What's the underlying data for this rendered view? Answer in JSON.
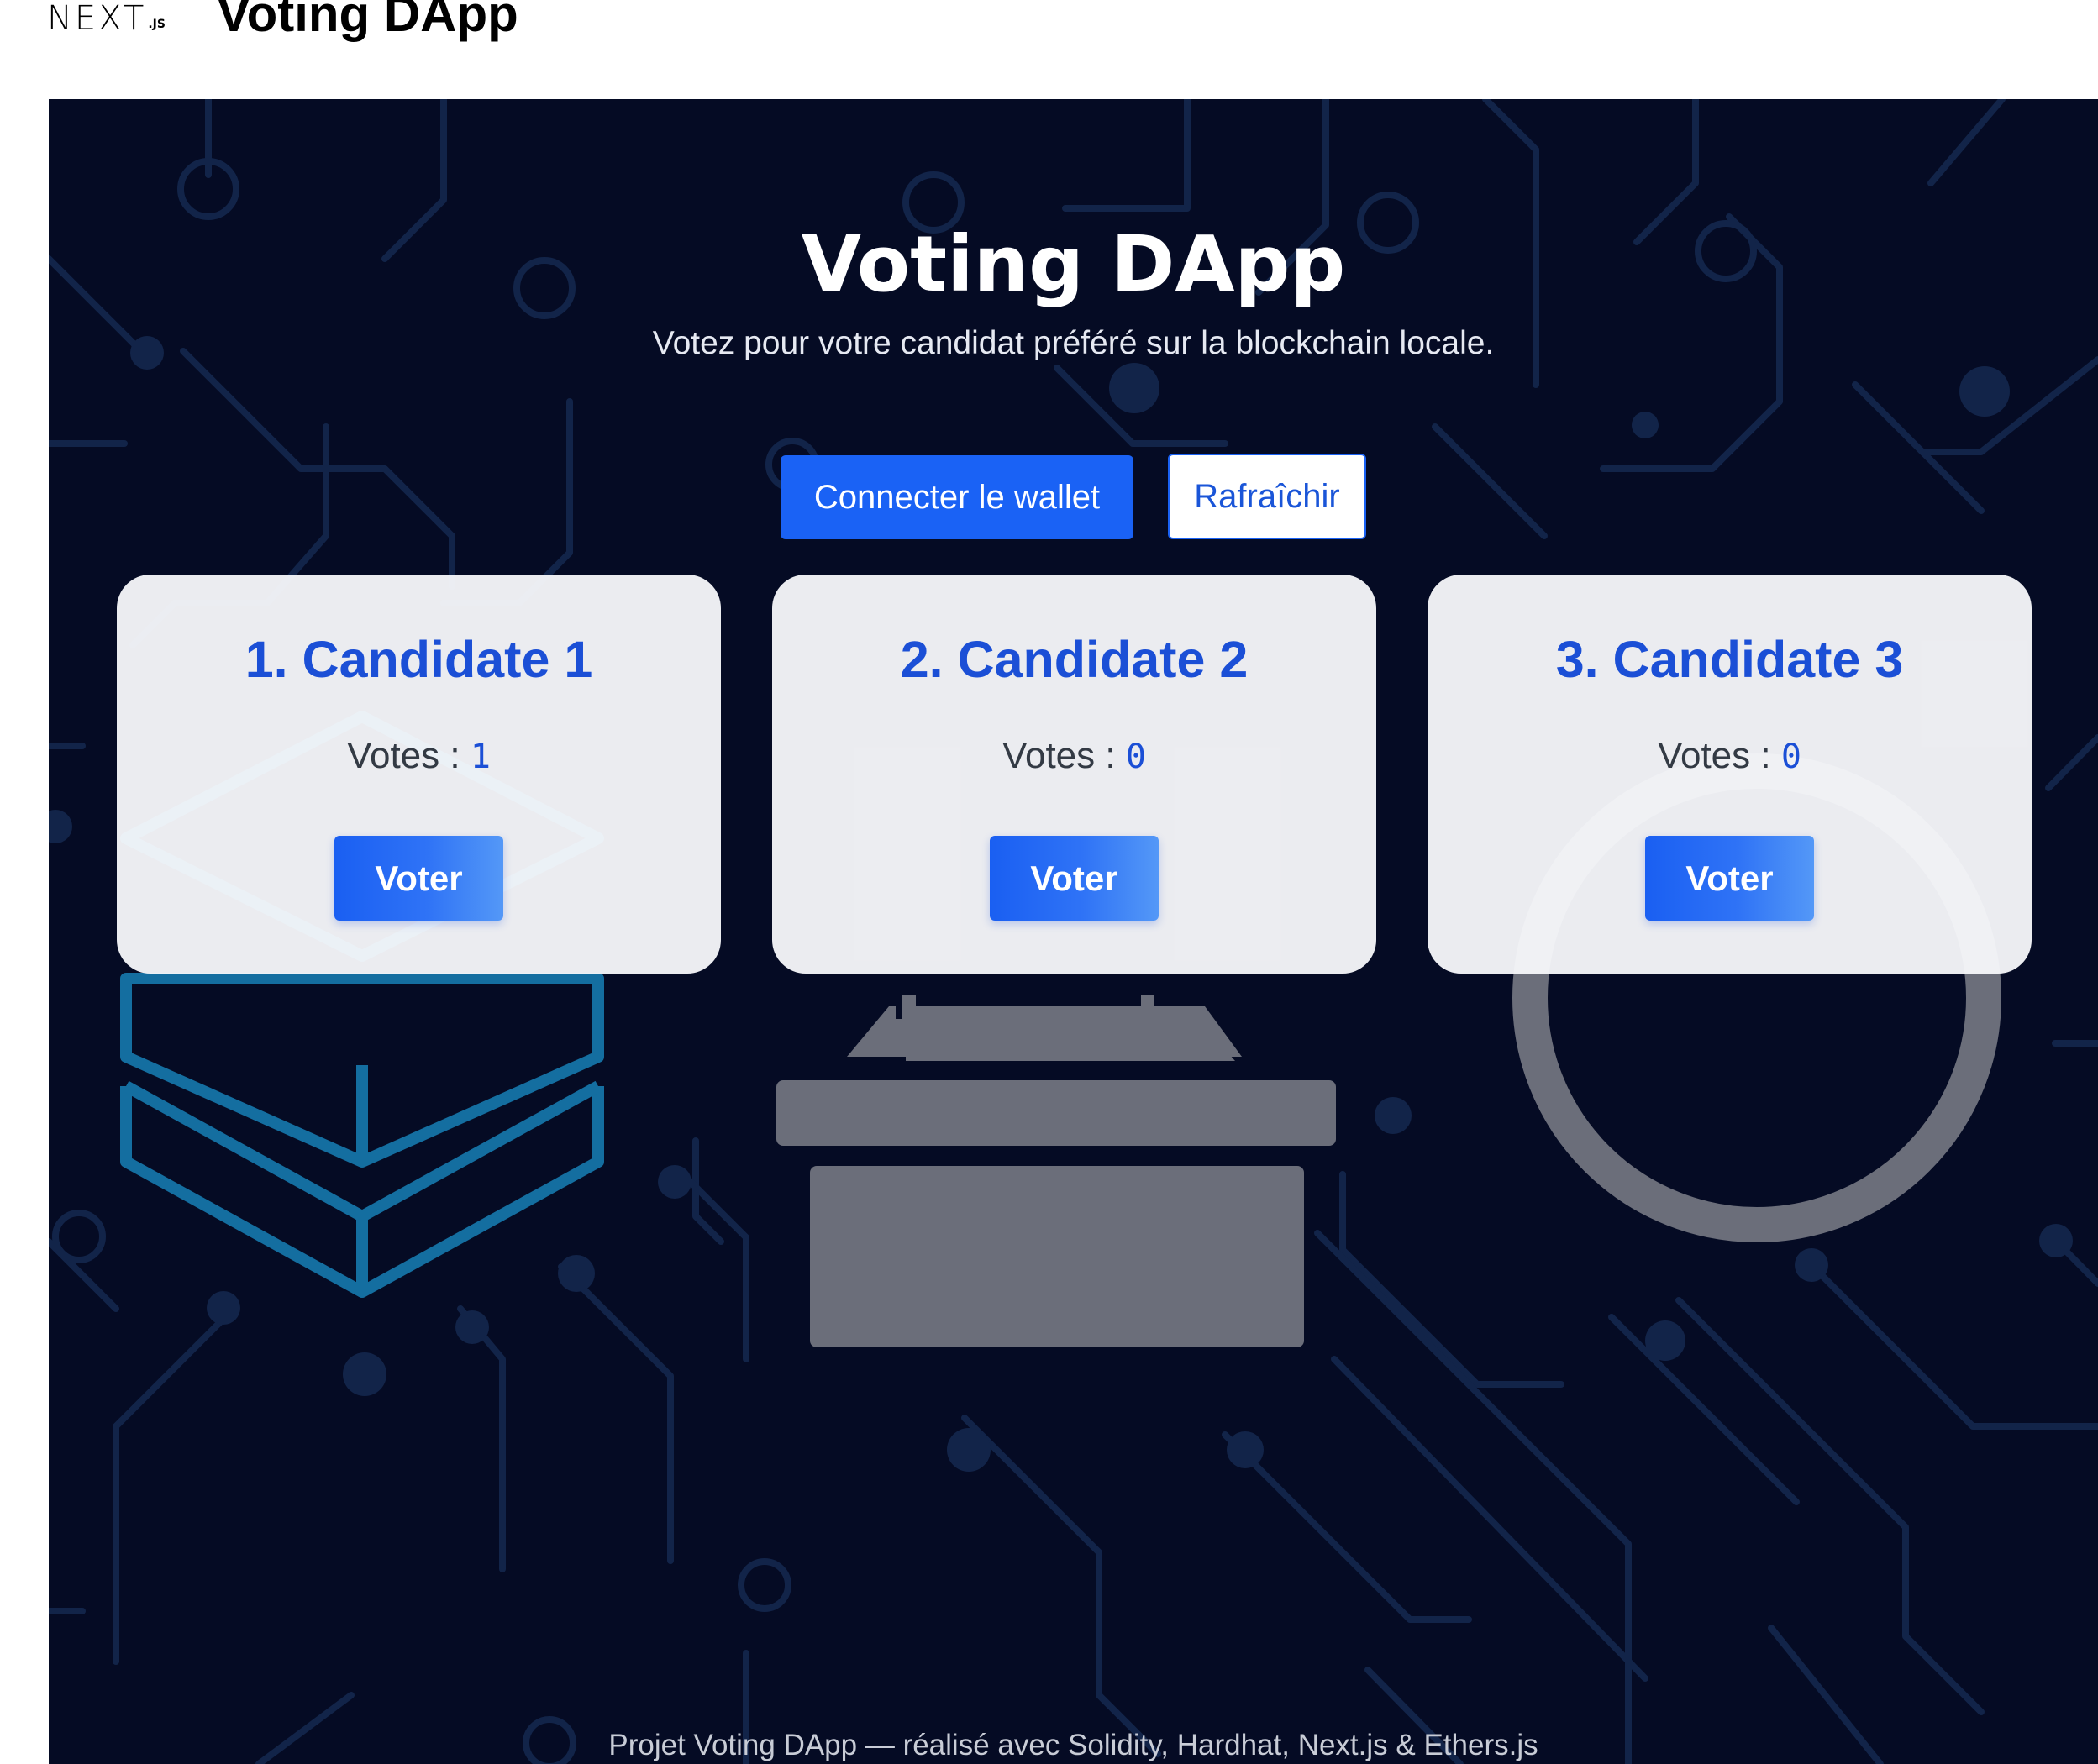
{
  "header": {
    "logo_main": "NEXT",
    "logo_suffix": ".JS",
    "title": "Voting DApp"
  },
  "hero": {
    "title": "Voting DApp",
    "subtitle": "Votez pour votre candidat préféré sur la blockchain locale."
  },
  "actions": {
    "connect_label": "Connecter le wallet",
    "refresh_label": "Rafraîchir"
  },
  "candidates": [
    {
      "name": "1. Candidate 1",
      "votes_label": "Votes : ",
      "votes": "1",
      "vote_label": "Voter"
    },
    {
      "name": "2. Candidate 2",
      "votes_label": "Votes : ",
      "votes": "0",
      "vote_label": "Voter"
    },
    {
      "name": "3. Candidate 3",
      "votes_label": "Votes : ",
      "votes": "0",
      "vote_label": "Voter"
    }
  ],
  "footer": {
    "text": "Projet Voting DApp — réalisé avec Solidity, Hardhat, Next.js & Ethers.js"
  },
  "colors": {
    "background": "#050b24",
    "circuit": "#122449",
    "primary": "#1a62f5",
    "heading_blue": "#1b4fd6",
    "illustration_gray": "#6b6e7a",
    "cube_teal": "#146ea0"
  },
  "illustrations": [
    "blockchain-cube-icon",
    "ballot-box-icon",
    "check-circle-icon"
  ]
}
